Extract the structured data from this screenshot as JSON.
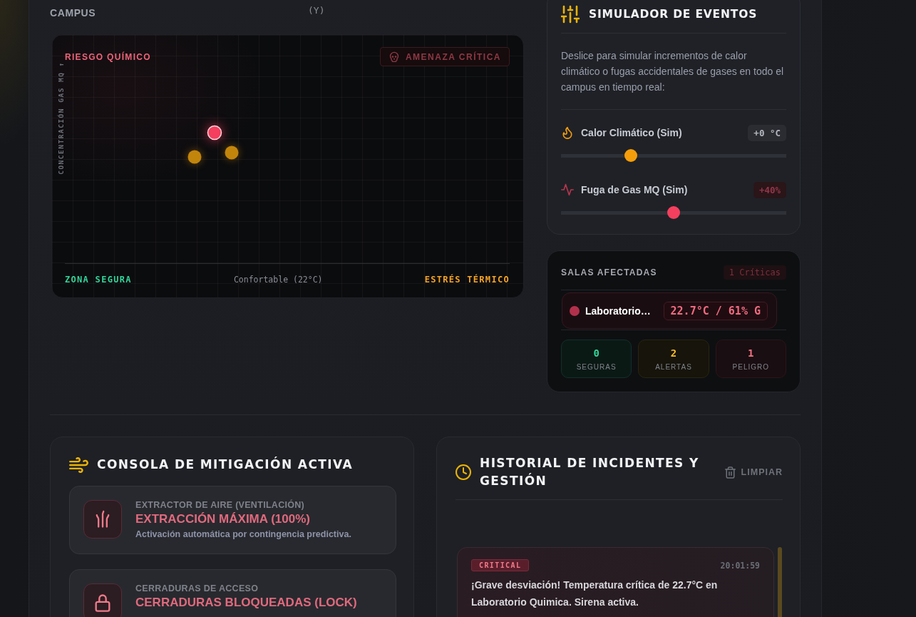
{
  "header": {
    "title": "CAMPUS",
    "subtitle": "(Y)"
  },
  "chart": {
    "y_axis_label": "CONCENTRACIÓN GAS MQ ↑",
    "top_left_label": "RIESGO QUÍMICO",
    "threat_badge": "AMENAZA CRÍTICA",
    "bottom_left_label": "ZONA SEGURA",
    "center_label": "Confortable (22°C)",
    "bottom_right_label": "ESTRÉS TÉRMICO"
  },
  "simulator": {
    "title": "SIMULADOR DE EVENTOS",
    "description": "Deslice para simular incrementos de calor climático o fugas accidentales de gases en todo el campus en tiempo real:",
    "sliders": [
      {
        "kind": "heat",
        "label": "Calor Climático (Sim)",
        "reading": "+0 °C",
        "level": 0.3
      },
      {
        "kind": "gas",
        "label": "Fuga de Gas MQ (Sim)",
        "reading": "+40%",
        "level": 0.5
      }
    ]
  },
  "affected_rooms": {
    "title": "SALAS AFECTADAS",
    "badge": "1 Críticas",
    "rooms": [
      {
        "kind": "danger",
        "name": "Laboratorio…",
        "reading": "22.7°C / 61% G"
      }
    ],
    "stats": [
      {
        "kind": "safe",
        "value": "0",
        "label": "SEGURAS"
      },
      {
        "kind": "warning",
        "value": "2",
        "label": "ALERTAS"
      },
      {
        "kind": "danger",
        "value": "1",
        "label": "PELIGRO"
      }
    ]
  },
  "mitigation": {
    "title": "CONSOLA DE MITIGACIÓN ACTIVA",
    "actions": [
      {
        "kind": "ventilation",
        "label": "EXTRACTOR DE AIRE (VENTILACIÓN)",
        "status": "EXTRACCIÓN MÁXIMA (100%)",
        "description": "Activación automática por contingencia predictiva."
      },
      {
        "kind": "lock",
        "label": "CERRADURAS DE ACCESO",
        "status": "CERRADURAS BLOQUEADAS (LOCK)"
      }
    ]
  },
  "history": {
    "title": "HISTORIAL DE INCIDENTES Y GESTIÓN",
    "clear_button": "LIMPIAR",
    "incidents": [
      {
        "kind": "critical",
        "badge": "CRITICAL",
        "time": "20:01:59",
        "message": "¡Grave desviación! Temperatura crítica de 22.7°C en Laboratorio Quimica. Sirena activa."
      }
    ]
  }
}
